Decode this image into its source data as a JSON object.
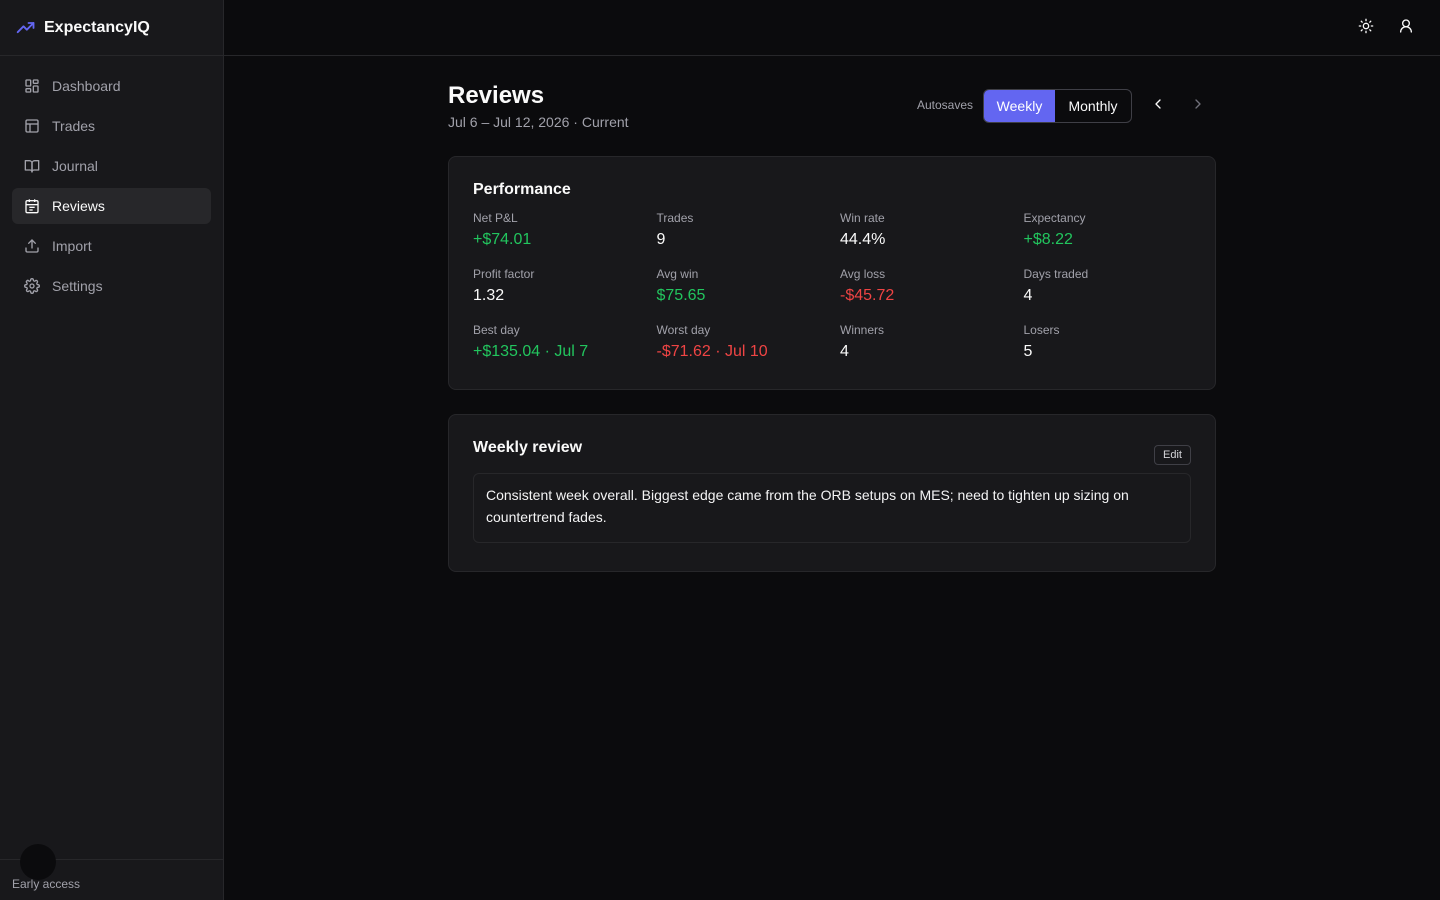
{
  "app": {
    "name": "ExpectancyIQ"
  },
  "sidebar": {
    "items": [
      {
        "label": "Dashboard",
        "icon": "dashboard-icon"
      },
      {
        "label": "Trades",
        "icon": "table-icon"
      },
      {
        "label": "Journal",
        "icon": "book-icon"
      },
      {
        "label": "Reviews",
        "icon": "calendar-icon",
        "active": true
      },
      {
        "label": "Import",
        "icon": "upload-icon"
      },
      {
        "label": "Settings",
        "icon": "gear-icon"
      }
    ],
    "footer": "Early access"
  },
  "header": {
    "title": "Reviews",
    "subtitle": "Jul 6 – Jul 12, 2026 · Current",
    "autosaves": "Autosaves",
    "weekly_label": "Weekly",
    "monthly_label": "Monthly",
    "selected_period": "Weekly"
  },
  "performance": {
    "title": "Performance",
    "stats": [
      {
        "label": "Net P&L",
        "value": "+$74.01",
        "tone": "pos"
      },
      {
        "label": "Trades",
        "value": "9",
        "tone": "neutral"
      },
      {
        "label": "Win rate",
        "value": "44.4%",
        "tone": "neutral"
      },
      {
        "label": "Expectancy",
        "value": "+$8.22",
        "tone": "pos"
      },
      {
        "label": "Profit factor",
        "value": "1.32",
        "tone": "neutral"
      },
      {
        "label": "Avg win",
        "value": "$75.65",
        "tone": "pos"
      },
      {
        "label": "Avg loss",
        "value": "-$45.72",
        "tone": "neg"
      },
      {
        "label": "Days traded",
        "value": "4",
        "tone": "neutral"
      },
      {
        "label": "Best day",
        "value": "+$135.04 · Jul 7",
        "tone": "pos"
      },
      {
        "label": "Worst day",
        "value": "-$71.62 · Jul 10",
        "tone": "neg"
      },
      {
        "label": "Winners",
        "value": "4",
        "tone": "neutral"
      },
      {
        "label": "Losers",
        "value": "5",
        "tone": "neutral"
      }
    ]
  },
  "review": {
    "title": "Weekly review",
    "edit_label": "Edit",
    "text": "Consistent week overall. Biggest edge came from the ORB setups on MES; need to tighten up sizing on countertrend fades."
  },
  "colors": {
    "accent": "#6366f1",
    "positive": "#22c55e",
    "negative": "#ef4444"
  }
}
